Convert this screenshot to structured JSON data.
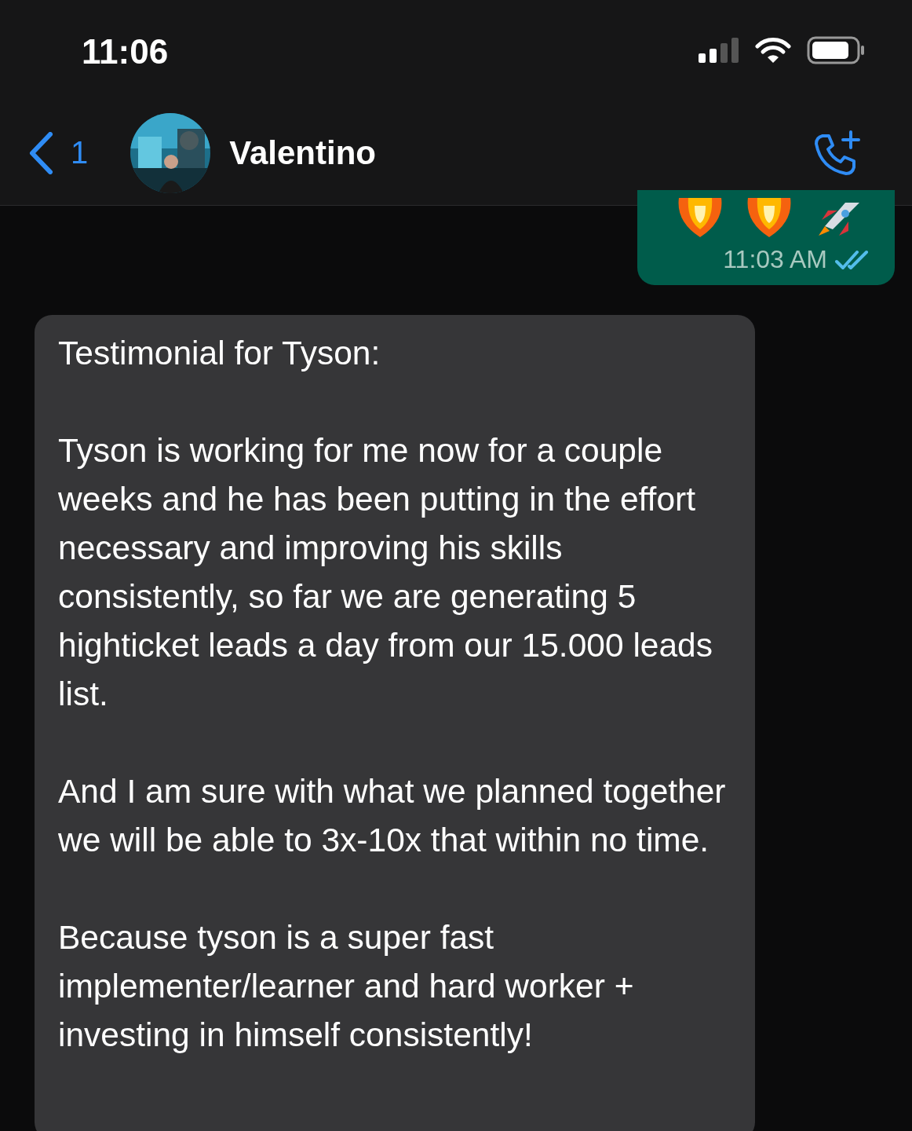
{
  "status_bar": {
    "time": "11:06"
  },
  "header": {
    "back_count": "1",
    "contact_name": "Valentino"
  },
  "messages": [
    {
      "kind": "sent",
      "time": "11:03 AM",
      "read": true
    },
    {
      "kind": "received",
      "paragraphs": [
        "Testimonial for Tyson:",
        "Tyson is working for me now for a couple weeks and he has been putting in the effort necessary and improving his skills consistently, so far we are generating 5 highticket leads a day from our 15.000 leads list.",
        "And I am sure with what we planned together we will be able to 3x-10x that within no time.",
        "Because tyson is a super fast implementer/learner and hard worker + investing in himself consistently!"
      ]
    }
  ]
}
